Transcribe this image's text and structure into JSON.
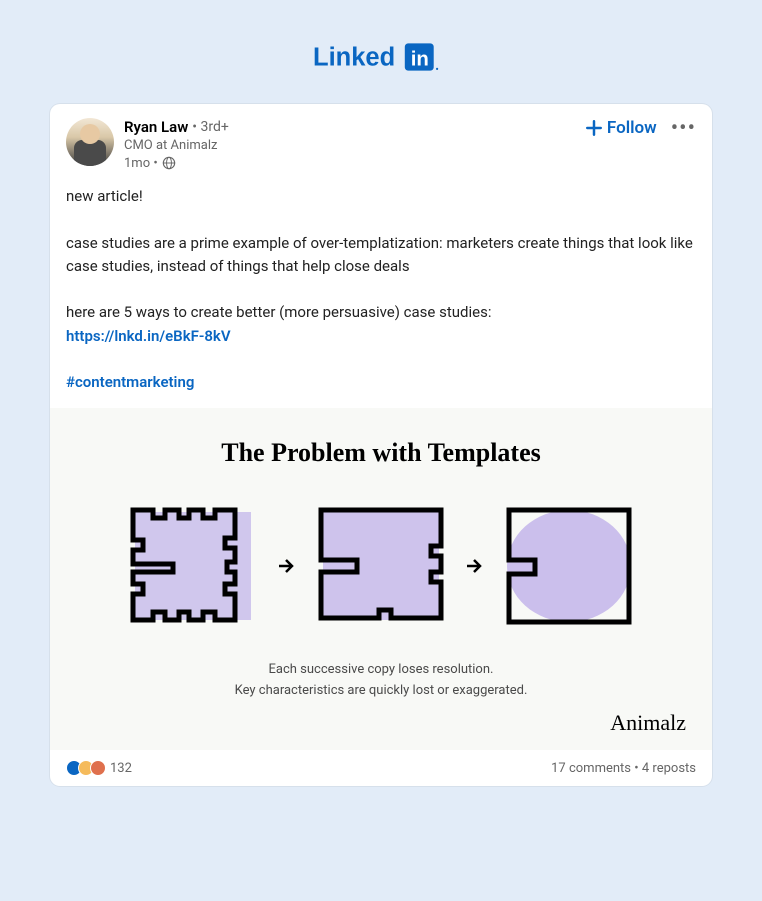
{
  "logo": {
    "text": "Linked",
    "badge": "in"
  },
  "post": {
    "author": {
      "name": "Ryan Law",
      "degree": "• 3rd+",
      "title": "CMO at Animalz",
      "time": "1mo •"
    },
    "actions": {
      "follow": "Follow"
    },
    "body": {
      "line1": "new article!",
      "line2": "case studies are a prime example of over-templatization: marketers create things that look like case studies, instead of things that help close deals",
      "line3": "here are 5 ways to create better (more persuasive) case studies:",
      "link": "https://lnkd.in/eBkF-8kV",
      "hashtag": "#contentmarketing"
    },
    "image": {
      "title": "The Problem with Templates",
      "caption1": "Each successive copy loses resolution.",
      "caption2": "Key characteristics are quickly lost or exaggerated.",
      "brand": "Animalz"
    },
    "footer": {
      "reaction_count": "132",
      "comments": "17 comments",
      "reposts": "4 reposts"
    }
  }
}
